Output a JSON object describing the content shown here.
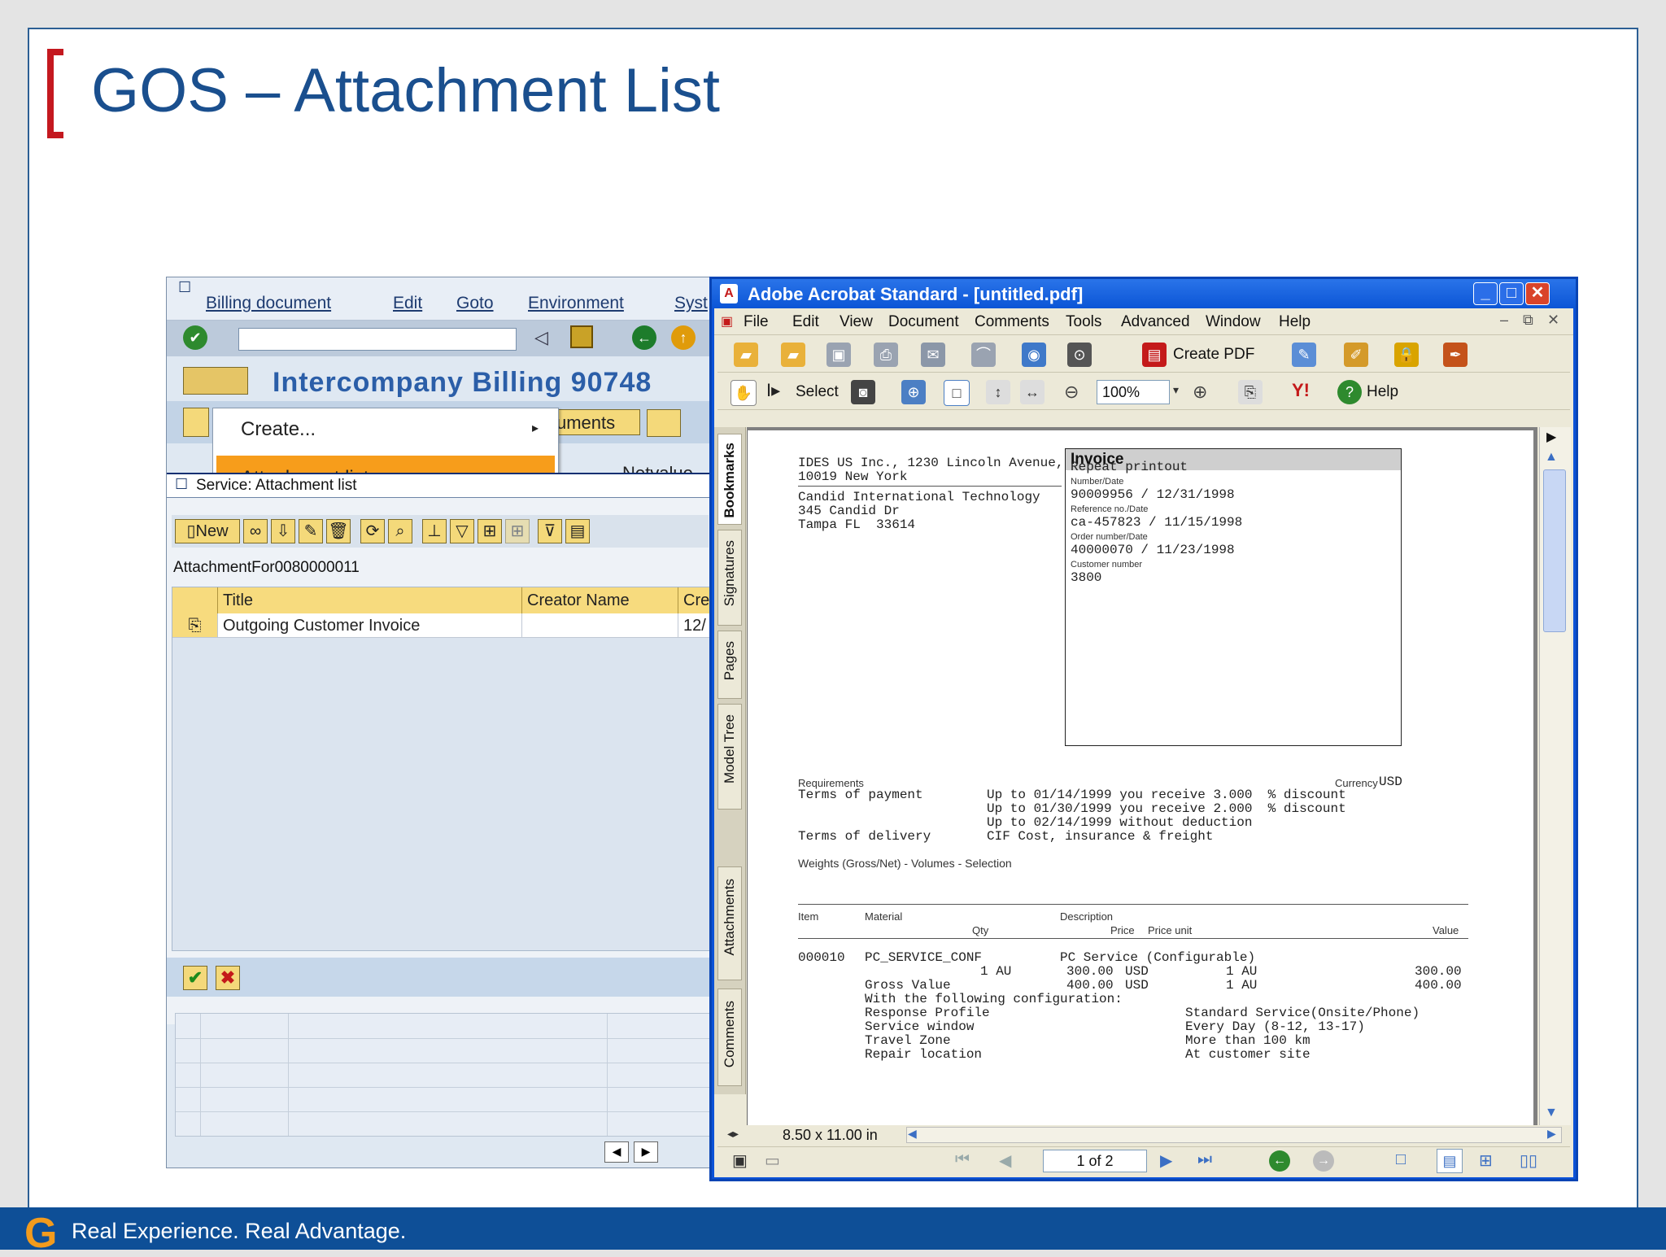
{
  "slide": {
    "title": "GOS – Attachment List",
    "footer_text": "Real Experience. Real Advantage.",
    "footer_logo": "G",
    "colors": {
      "accent_red": "#c4181f",
      "title_blue": "#1a4f8e",
      "footer_blue": "#0e4f97",
      "logo_orange": "#f29b1d"
    }
  },
  "sap": {
    "menu": [
      "Billing document",
      "Edit",
      "Goto",
      "Environment",
      "Syst"
    ],
    "title": "Intercompany Billing 90748",
    "app_button_partial": "uments",
    "context_menu": {
      "items": [
        {
          "label": "Create..."
        },
        {
          "label": "Attachment list"
        }
      ],
      "partial_behind": "Netvalue"
    },
    "dialog": {
      "title": "Service: Attachment list",
      "new_button": "New",
      "object_label": "AttachmentFor0080000011",
      "columns": [
        "Title",
        "Creator Name",
        "Cre"
      ],
      "rows": [
        {
          "title": "Outgoing Customer Invoice",
          "creator": "",
          "created": "12/"
        }
      ]
    }
  },
  "acrobat": {
    "window_title": "Adobe Acrobat Standard - [untitled.pdf]",
    "menu": [
      "File",
      "Edit",
      "View",
      "Document",
      "Comments",
      "Tools",
      "Advanced",
      "Window",
      "Help"
    ],
    "toolbar": {
      "create_pdf": "Create PDF",
      "select": "Select",
      "zoom": "100%",
      "help": "Help"
    },
    "side_tabs": [
      "Bookmarks",
      "Signatures",
      "Pages",
      "Model Tree",
      "Attachments",
      "Comments"
    ],
    "status": {
      "page_size": "8.50 x 11.00 in",
      "page_counter": "1 of 2"
    },
    "document": {
      "sender_line1": "IDES US Inc., 1230 Lincoln Avenue,",
      "sender_line2": "10019 New York",
      "recipient": [
        "Candid International Technology",
        "345 Candid Dr",
        "Tampa FL  33614"
      ],
      "invoice": {
        "heading": "Invoice",
        "subtitle": "Repeat printout",
        "number_date_label": "Number/Date",
        "number_date": "90009956 / 12/31/1998",
        "reference_label": "Reference no./Date",
        "reference": "ca-457823 / 11/15/1998",
        "order_label": "Order number/Date",
        "order": "40000070 / 11/23/1998",
        "customer_label": "Customer number",
        "customer": "3800"
      },
      "requirements_label": "Requirements",
      "currency_label": "Currency",
      "currency": "USD",
      "terms_payment_label": "Terms of payment",
      "terms_payment": [
        "Up to 01/14/1999 you receive 3.000  % discount",
        "Up to 01/30/1999 you receive 2.000  % discount",
        "Up to 02/14/1999 without deduction"
      ],
      "terms_delivery_label": "Terms of delivery",
      "terms_delivery": "CIF Cost, insurance & freight",
      "weights_line": "Weights (Gross/Net) - Volumes - Selection",
      "table_headers": {
        "item": "Item",
        "material": "Material",
        "description": "Description",
        "qty": "Qty",
        "price": "Price",
        "price_unit": "Price unit",
        "value": "Value"
      },
      "line_item": {
        "item": "000010",
        "material": "PC_SERVICE_CONF",
        "description": "PC Service (Configurable)",
        "qty": "1 AU",
        "price": "300.00",
        "currency": "USD",
        "unit": "1 AU",
        "value": "300.00",
        "gross_label": "Gross Value",
        "gross_price": "400.00",
        "gross_currency": "USD",
        "gross_unit": "1 AU",
        "gross_value": "400.00",
        "config_intro": "With the following configuration:",
        "config": [
          {
            "name": "Response Profile",
            "value": "Standard Service(Onsite/Phone)"
          },
          {
            "name": "Service window",
            "value": "Every Day (8-12, 13-17)"
          },
          {
            "name": "Travel Zone",
            "value": "More than 100 km"
          },
          {
            "name": "Repair location",
            "value": "At customer site"
          }
        ]
      }
    }
  }
}
